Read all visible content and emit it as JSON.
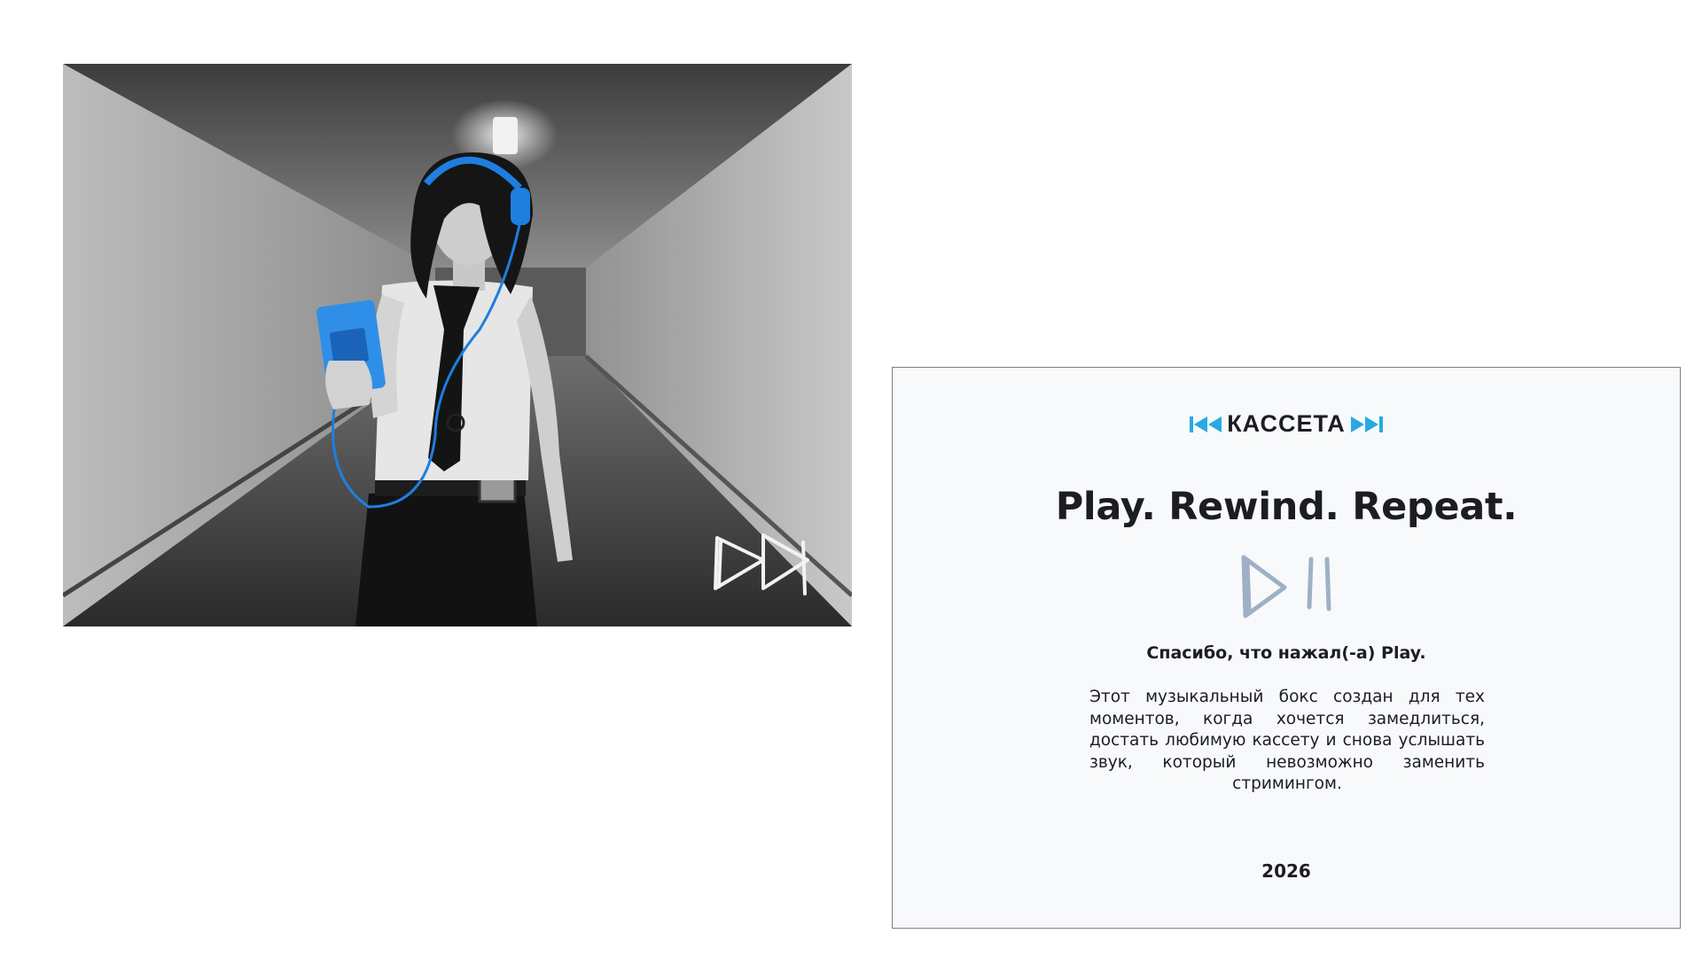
{
  "photo": {
    "description_icon": "corridor-photo",
    "accent_color": "#1e7fe0"
  },
  "card": {
    "logo": {
      "text": "КАССЕТА",
      "accent_color": "#29a9e1"
    },
    "headline": "Play. Rewind. Repeat.",
    "thanks_line": "Спасибо, что нажал(-а) Play.",
    "body": "Этот музыкальный бокс создан для тех моментов, когда хочется замедлиться, достать любимую кассету и снова услышать звук, который невозможно заменить стримингом.",
    "year": "2026",
    "icon_color": "#9fb0c6"
  }
}
